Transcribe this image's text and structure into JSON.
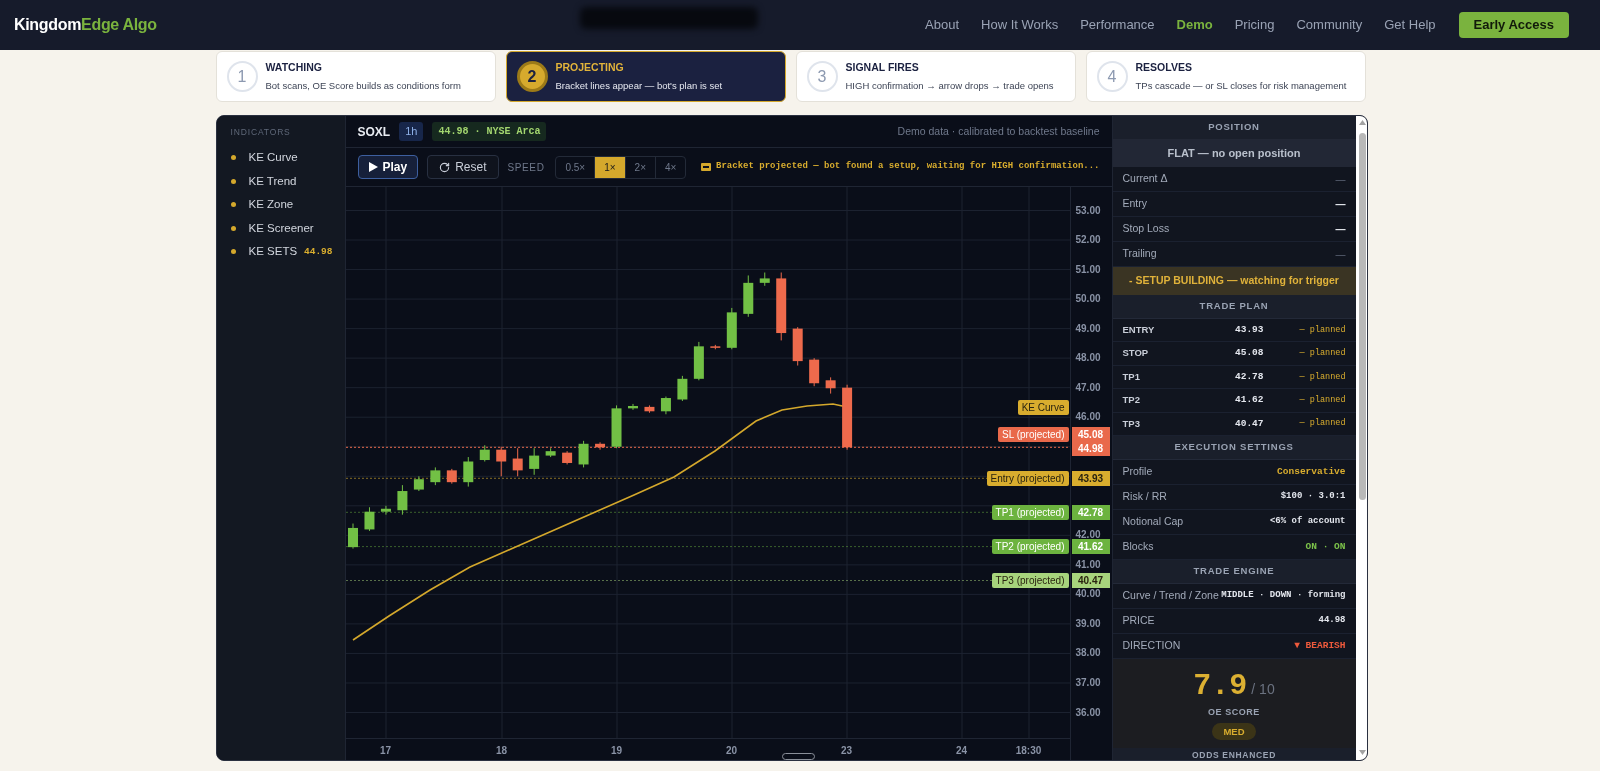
{
  "nav": {
    "logo": {
      "part_1": "Kingdom",
      "part_2": "Edge Algo"
    },
    "links": [
      {
        "label": "About",
        "selected": false
      },
      {
        "label": "How It Works",
        "selected": false
      },
      {
        "label": "Performance",
        "selected": false
      },
      {
        "label": "Demo",
        "selected": true
      },
      {
        "label": "Pricing",
        "selected": false
      },
      {
        "label": "Community",
        "selected": false
      },
      {
        "label": "Get Help",
        "selected": false
      }
    ],
    "cta": "Early Access"
  },
  "steps": [
    {
      "number": "1",
      "title": "WATCHING",
      "text": "Bot scans, OE Score builds as conditions form",
      "selected": false
    },
    {
      "number": "2",
      "title": "PROJECTING",
      "text": "Bracket lines appear — bot's plan is set",
      "selected": true
    },
    {
      "number": "3",
      "title": "SIGNAL FIRES",
      "text": "HIGH confirmation → arrow drops → trade opens",
      "selected": false
    },
    {
      "number": "4",
      "title": "RESOLVES",
      "text": "TPs cascade — or SL closes for risk management",
      "selected": false
    }
  ],
  "indicators": {
    "title": "INDICATORS",
    "items": [
      {
        "label": "KE Curve"
      },
      {
        "label": "KE Trend"
      },
      {
        "label": "KE Zone"
      },
      {
        "label": "KE Screener"
      },
      {
        "label": "KE SETS",
        "value": "44.98"
      }
    ]
  },
  "chart_header": {
    "symbol": "SOXL",
    "interval": "1h",
    "quote": "44.98 · NYSE Arca",
    "note": "Demo data · calibrated to backtest baseline"
  },
  "controls": {
    "play": "Play",
    "reset": "Reset",
    "speed_label": "SPEED",
    "speeds": [
      {
        "label": "0.5×",
        "selected": false
      },
      {
        "label": "1×",
        "selected": true
      },
      {
        "label": "2×",
        "selected": false
      },
      {
        "label": "4×",
        "selected": false
      }
    ],
    "status": "Bracket projected — bot found a setup, waiting for HIGH confirmation..."
  },
  "chart": {
    "price_axis": [
      "53.00",
      "52.00",
      "51.00",
      "50.00",
      "49.00",
      "48.00",
      "47.00",
      "46.00",
      "42.00",
      "41.00",
      "40.00",
      "39.00",
      "38.00",
      "37.00",
      "36.00"
    ],
    "time_axis": [
      "17",
      "18",
      "19",
      "20",
      "23",
      "24",
      "18:30"
    ],
    "tags": [
      {
        "kind": "curve",
        "label": "KE Curve",
        "color": "#d9ad2e"
      },
      {
        "kind": "stop",
        "label": "SL (projected)",
        "price": "45.08",
        "color": "#e9694b"
      },
      {
        "kind": "last",
        "price": "44.98",
        "color": "#e9694b"
      },
      {
        "kind": "entry",
        "label": "Entry (projected)",
        "price": "43.93",
        "color": "#d9ad2e"
      },
      {
        "kind": "target",
        "label": "TP1 (projected)",
        "price": "42.78",
        "color": "#6cb33f"
      },
      {
        "kind": "target",
        "label": "TP2 (projected)",
        "price": "41.62",
        "color": "#6cb33f"
      },
      {
        "kind": "target",
        "label": "TP3 (projected)",
        "price": "40.47",
        "color": "#a7d47c"
      }
    ]
  },
  "position": {
    "title": "POSITION",
    "status": "FLAT — no open position",
    "rows": [
      {
        "label": "Current Δ",
        "value": "—",
        "muted": true
      },
      {
        "label": "Entry",
        "value": "—",
        "muted": false
      },
      {
        "label": "Stop Loss",
        "value": "—",
        "muted": false
      },
      {
        "label": "Trailing",
        "value": "—",
        "muted": true
      }
    ]
  },
  "setup_banner": "- SETUP BUILDING — watching for trigger",
  "trade_plan": {
    "title": "TRADE PLAN",
    "rows": [
      {
        "label": "ENTRY",
        "value": "43.93",
        "status": "— planned"
      },
      {
        "label": "STOP",
        "value": "45.08",
        "status": "— planned"
      },
      {
        "label": "TP1",
        "value": "42.78",
        "status": "— planned"
      },
      {
        "label": "TP2",
        "value": "41.62",
        "status": "— planned"
      },
      {
        "label": "TP3",
        "value": "40.47",
        "status": "— planned"
      }
    ]
  },
  "execution": {
    "title": "EXECUTION SETTINGS",
    "rows": [
      {
        "label": "Profile",
        "value": "Conservative",
        "kind": "accent"
      },
      {
        "label": "Risk / RR",
        "value": "$100 · 3.0:1",
        "kind": "plain"
      },
      {
        "label": "Notional Cap",
        "value": "<6% of account",
        "kind": "plain"
      },
      {
        "label": "Blocks",
        "value": "ON · ON",
        "kind": "positive"
      }
    ]
  },
  "engine": {
    "title": "TRADE ENGINE",
    "rows": [
      {
        "label": "Curve / Trend / Zone",
        "value": "MIDDLE · DOWN · forming",
        "kind": "plain"
      },
      {
        "label": "PRICE",
        "value": "44.98",
        "kind": "plain"
      },
      {
        "label": "DIRECTION",
        "value": "▼ BEARISH",
        "kind": "negative"
      }
    ]
  },
  "score": {
    "value": "7.9",
    "scale": "/ 10",
    "label": "OE SCORE",
    "grade": "MED"
  },
  "next_section": "ODDS ENHANCED"
}
